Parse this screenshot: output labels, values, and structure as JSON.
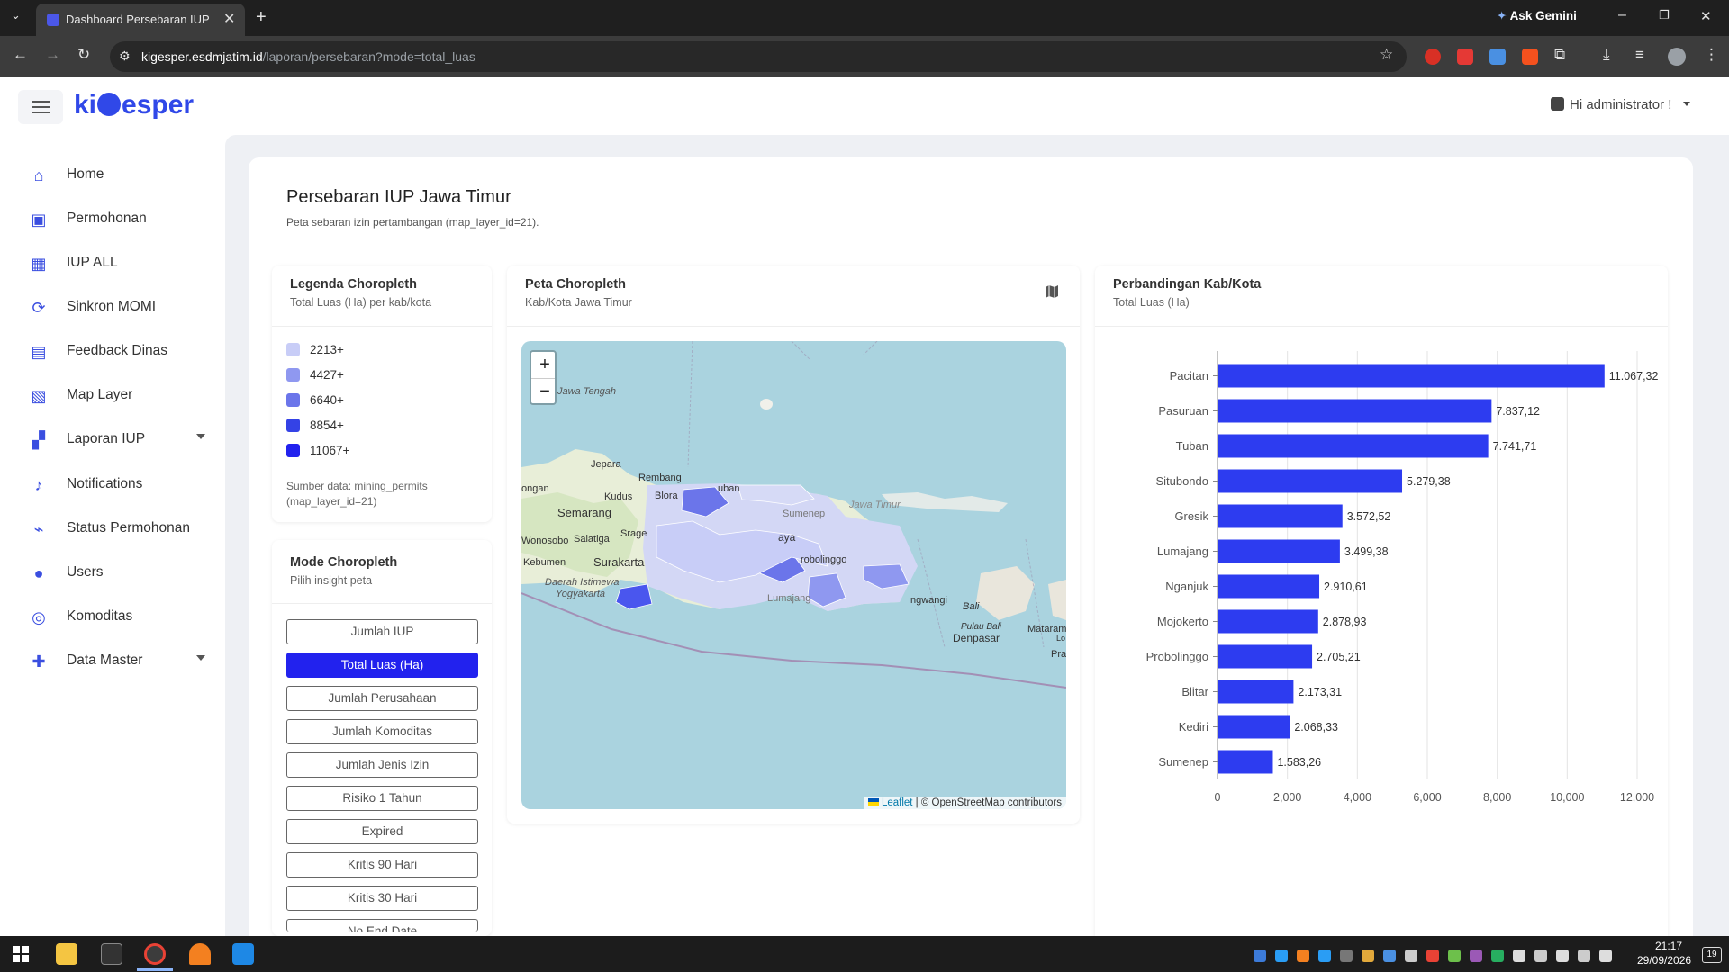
{
  "browser": {
    "tab_title": "Dashboard Persebaran IUP",
    "url_host": "kigesper.esdmjatim.id",
    "url_path": "/laporan/persebaran?mode=total_luas",
    "ask_gemini": "Ask Gemini"
  },
  "app": {
    "logo_prefix": "ki",
    "logo_suffix": "esper",
    "user_greeting": "Hi administrator !"
  },
  "sidebar": {
    "items": [
      {
        "label": "Home",
        "icon": "home-icon"
      },
      {
        "label": "Permohonan",
        "icon": "briefcase-icon"
      },
      {
        "label": "IUP ALL",
        "icon": "table-icon"
      },
      {
        "label": "Sinkron MOMI",
        "icon": "sync-icon"
      },
      {
        "label": "Feedback Dinas",
        "icon": "clipboard-user-icon"
      },
      {
        "label": "Map Layer",
        "icon": "map-icon"
      },
      {
        "label": "Laporan IUP",
        "icon": "dashboard-icon"
      },
      {
        "label": "Notifications",
        "icon": "bell-icon"
      },
      {
        "label": "Status Permohonan",
        "icon": "router-icon"
      },
      {
        "label": "Users",
        "icon": "users-icon"
      },
      {
        "label": "Komoditas",
        "icon": "ring-icon"
      },
      {
        "label": "Data Master",
        "icon": "puzzle-icon"
      }
    ]
  },
  "page": {
    "title": "Persebaran IUP Jawa Timur",
    "subtitle": "Peta sebaran izin pertambangan (map_layer_id=21)."
  },
  "legend": {
    "title": "Legenda Choropleth",
    "subtitle": "Total Luas (Ha) per kab/kota",
    "items": [
      {
        "label": "2213+",
        "color": "#c8cdf7"
      },
      {
        "label": "4427+",
        "color": "#8f98f0"
      },
      {
        "label": "6640+",
        "color": "#6b75ea"
      },
      {
        "label": "8854+",
        "color": "#3442e6"
      },
      {
        "label": "11067+",
        "color": "#2222ee"
      }
    ],
    "source_line1": "Sumber data: mining_permits",
    "source_line2": "(map_layer_id=21)"
  },
  "mode": {
    "title": "Mode Choropleth",
    "subtitle": "Pilih insight peta",
    "buttons": [
      {
        "label": "Jumlah IUP",
        "active": false
      },
      {
        "label": "Total Luas (Ha)",
        "active": true
      },
      {
        "label": "Jumlah Perusahaan",
        "active": false
      },
      {
        "label": "Jumlah Komoditas",
        "active": false
      },
      {
        "label": "Jumlah Jenis Izin",
        "active": false
      },
      {
        "label": "Risiko 1 Tahun",
        "active": false
      },
      {
        "label": "Expired",
        "active": false
      },
      {
        "label": "Kritis 90 Hari",
        "active": false
      },
      {
        "label": "Kritis 30 Hari",
        "active": false
      },
      {
        "label": "No End Date",
        "active": false
      }
    ]
  },
  "map": {
    "title": "Peta Choropleth",
    "subtitle": "Kab/Kota Jawa Timur",
    "zoom_in": "+",
    "zoom_out": "−",
    "labels": [
      "Jawa Tengah",
      "Jepara",
      "Rembang",
      "Kudus",
      "Blora",
      "Semarang",
      "Wonosobo",
      "Salatiga",
      "Kebumen",
      "Surakarta",
      "Daerah Istimewa",
      "Yogyakarta",
      "Bali",
      "Pulau Bali",
      "Denpasar",
      "Mataram",
      "ongan",
      "Srage",
      "uban",
      "aya",
      "robolinggo",
      "Jawa Timur",
      "Sumenep",
      "ngwangi",
      "Lumajang",
      "Pra",
      "Lo"
    ],
    "attribution_leaflet": "Leaflet",
    "attribution_rest": "| © OpenStreetMap contributors"
  },
  "chart_card": {
    "title": "Perbandingan Kab/Kota",
    "subtitle": "Total Luas (Ha)"
  },
  "chart_data": {
    "type": "bar",
    "orientation": "horizontal",
    "categories": [
      "Pacitan",
      "Pasuruan",
      "Tuban",
      "Situbondo",
      "Gresik",
      "Lumajang",
      "Nganjuk",
      "Mojokerto",
      "Probolinggo",
      "Blitar",
      "Kediri",
      "Sumenep"
    ],
    "values": [
      11067.32,
      7837.12,
      7741.71,
      5279.38,
      3572.52,
      3499.38,
      2910.61,
      2878.93,
      2705.21,
      2173.31,
      2068.33,
      1583.26
    ],
    "value_labels": [
      "11.067,32",
      "7.837,12",
      "7.741,71",
      "5.279,38",
      "3.572,52",
      "3.499,38",
      "2.910,61",
      "2.878,93",
      "2.705,21",
      "2.173,31",
      "2.068,33",
      "1.583,26"
    ],
    "xlim": [
      0,
      12000
    ],
    "xticks": [
      0,
      2000,
      4000,
      6000,
      8000,
      10000,
      12000
    ],
    "xtick_labels": [
      "0",
      "2,000",
      "4,000",
      "6,000",
      "8,000",
      "10,000",
      "12,000"
    ],
    "bar_color": "#2d3cf0",
    "grid": true
  },
  "taskbar": {
    "time": "21:17",
    "date": "29/09/2026",
    "notif_count": "19"
  }
}
